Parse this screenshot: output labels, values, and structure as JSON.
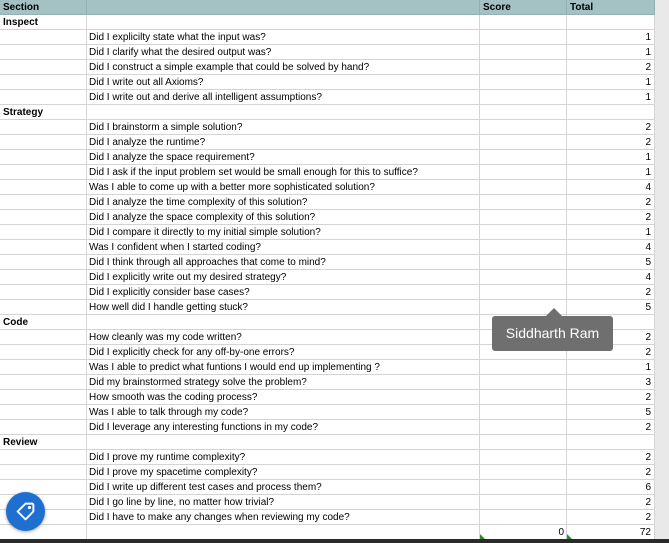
{
  "header": {
    "section": "Section",
    "question": "",
    "score": "Score",
    "total": "Total"
  },
  "rows": [
    {
      "section": "Inspect",
      "question": "",
      "score": "",
      "total": ""
    },
    {
      "section": "",
      "question": "Did I explicilty state what the input was?",
      "score": "",
      "total": "1"
    },
    {
      "section": "",
      "question": "Did I clarify what the desired output was?",
      "score": "",
      "total": "1"
    },
    {
      "section": "",
      "question": "Did I construct a simple example that could be solved by hand?",
      "score": "",
      "total": "2"
    },
    {
      "section": "",
      "question": "Did I write out all Axioms?",
      "score": "",
      "total": "1"
    },
    {
      "section": "",
      "question": "Did I write out and derive all intelligent assumptions?",
      "score": "",
      "total": "1"
    },
    {
      "section": "Strategy",
      "question": "",
      "score": "",
      "total": ""
    },
    {
      "section": "",
      "question": "Did I brainstorm a simple solution?",
      "score": "",
      "total": "2"
    },
    {
      "section": "",
      "question": "Did I analyze the runtime?",
      "score": "",
      "total": "2"
    },
    {
      "section": "",
      "question": "Did I analyze the space requirement?",
      "score": "",
      "total": "1"
    },
    {
      "section": "",
      "question": "Did I ask if the input problem set would be small enough for this to suffice?",
      "score": "",
      "total": "1"
    },
    {
      "section": "",
      "question": "Was I able to come up with a better more sophisticated solution?",
      "score": "",
      "total": "4"
    },
    {
      "section": "",
      "question": "Did I analyze the time complexity of this solution?",
      "score": "",
      "total": "2"
    },
    {
      "section": "",
      "question": "Did I analyze the space complexity of this solution?",
      "score": "",
      "total": "2"
    },
    {
      "section": "",
      "question": "Did I compare it directly to my initial simple solution?",
      "score": "",
      "total": "1"
    },
    {
      "section": "",
      "question": "Was I confident when I started coding?",
      "score": "",
      "total": "4"
    },
    {
      "section": "",
      "question": "Did I think through all approaches that come to mind?",
      "score": "",
      "total": "5"
    },
    {
      "section": "",
      "question": "Did I explicitly write out my desired strategy?",
      "score": "",
      "total": "4"
    },
    {
      "section": "",
      "question": "Did I explicitly consider base cases?",
      "score": "",
      "total": "2"
    },
    {
      "section": "",
      "question": "How well did I handle getting stuck?",
      "score": "",
      "total": "5"
    },
    {
      "section": "Code",
      "question": "",
      "score": "",
      "total": ""
    },
    {
      "section": "",
      "question": "How cleanly was my code written?",
      "score": "",
      "total": "2"
    },
    {
      "section": "",
      "question": "Did I explicitly check for any off-by-one errors?",
      "score": "",
      "total": "2"
    },
    {
      "section": "",
      "question": "Was I able to predict what funtions I would end up implementing ?",
      "score": "",
      "total": "1"
    },
    {
      "section": "",
      "question": "Did my brainstormed strategy solve the problem?",
      "score": "",
      "total": "3"
    },
    {
      "section": "",
      "question": "How smooth was the coding process?",
      "score": "",
      "total": "2"
    },
    {
      "section": "",
      "question": "Was I able to talk through my code?",
      "score": "",
      "total": "5"
    },
    {
      "section": "",
      "question": "Did I leverage any interesting functions in my code?",
      "score": "",
      "total": "2"
    },
    {
      "section": "Review",
      "question": "",
      "score": "",
      "total": ""
    },
    {
      "section": "",
      "question": "Did I prove my runtime complexity?",
      "score": "",
      "total": "2"
    },
    {
      "section": "",
      "question": "Did I prove my spacetime complexity?",
      "score": "",
      "total": "2"
    },
    {
      "section": "",
      "question": "Did I write up different test cases and process them?",
      "score": "",
      "total": "6"
    },
    {
      "section": "",
      "question": "Did I go line by line, no matter how trivial?",
      "score": "",
      "total": "2"
    },
    {
      "section": "",
      "question": "Did I have to make any changes when reviewing my code?",
      "score": "",
      "total": "2"
    },
    {
      "section": "",
      "question": "",
      "score": "0",
      "total": "72"
    }
  ],
  "tooltip": {
    "text": "Siddharth Ram"
  },
  "fab": {
    "icon": "tag-icon",
    "color": "#1f6fd0"
  },
  "colors": {
    "header_bg": "#a4c2c4",
    "marker": "#2e8b2e"
  }
}
